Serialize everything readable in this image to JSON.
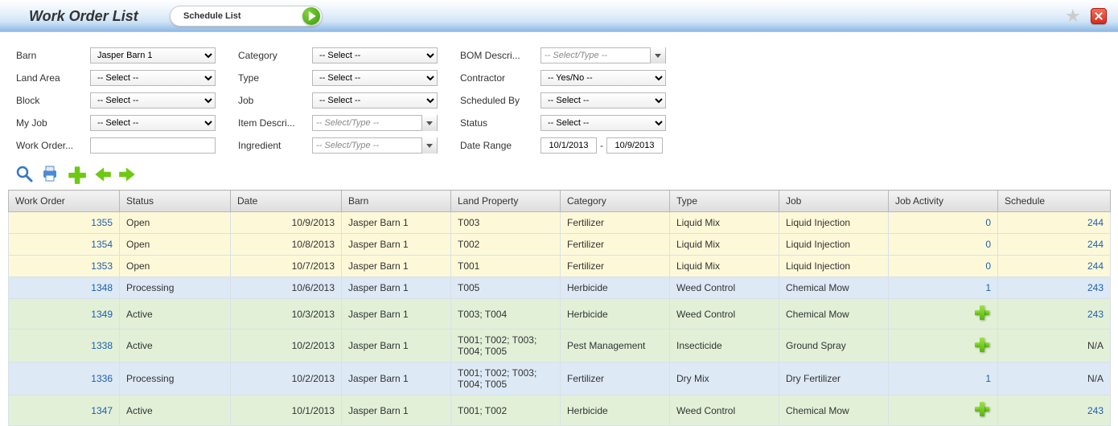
{
  "header": {
    "title": "Work Order List",
    "schedule_btn": "Schedule List"
  },
  "filters": {
    "col1": [
      {
        "label": "Barn",
        "type": "select",
        "value": "Jasper Barn 1"
      },
      {
        "label": "Land Area",
        "type": "select",
        "value": "-- Select --"
      },
      {
        "label": "Block",
        "type": "select",
        "value": "-- Select --"
      },
      {
        "label": "My Job",
        "type": "select",
        "value": "-- Select --"
      },
      {
        "label": "Work Order...",
        "type": "text",
        "value": ""
      }
    ],
    "col2": [
      {
        "label": "Category",
        "type": "select",
        "value": "-- Select --"
      },
      {
        "label": "Type",
        "type": "select",
        "value": "-- Select --"
      },
      {
        "label": "Job",
        "type": "select",
        "value": "-- Select --"
      },
      {
        "label": "Item Descri...",
        "type": "combo",
        "placeholder": "-- Select/Type --"
      },
      {
        "label": "Ingredient",
        "type": "combo",
        "placeholder": "-- Select/Type --"
      }
    ],
    "col3": [
      {
        "label": "BOM Descri...",
        "type": "combo",
        "placeholder": "-- Select/Type --"
      },
      {
        "label": "Contractor",
        "type": "select",
        "value": "-- Yes/No --"
      },
      {
        "label": "Scheduled By",
        "type": "select",
        "value": "-- Select --"
      },
      {
        "label": "Status",
        "type": "select",
        "value": "-- Select --"
      },
      {
        "label": "Date Range",
        "type": "daterange",
        "from": "10/1/2013",
        "to": "10/9/2013"
      }
    ]
  },
  "grid": {
    "columns": [
      "Work Order",
      "Status",
      "Date",
      "Barn",
      "Land Property",
      "Category",
      "Type",
      "Job",
      "Job Activity",
      "Schedule"
    ],
    "rows": [
      {
        "cls": "open",
        "wo": "1355",
        "status": "Open",
        "date": "10/9/2013",
        "barn": "Jasper Barn 1",
        "land": "T003",
        "cat": "Fertilizer",
        "type": "Liquid Mix",
        "job": "Liquid Injection",
        "act_kind": "link",
        "act_val": "0",
        "sched": "244"
      },
      {
        "cls": "open",
        "wo": "1354",
        "status": "Open",
        "date": "10/8/2013",
        "barn": "Jasper Barn 1",
        "land": "T002",
        "cat": "Fertilizer",
        "type": "Liquid Mix",
        "job": "Liquid Injection",
        "act_kind": "link",
        "act_val": "0",
        "sched": "244"
      },
      {
        "cls": "open",
        "wo": "1353",
        "status": "Open",
        "date": "10/7/2013",
        "barn": "Jasper Barn 1",
        "land": "T001",
        "cat": "Fertilizer",
        "type": "Liquid Mix",
        "job": "Liquid Injection",
        "act_kind": "link",
        "act_val": "0",
        "sched": "244"
      },
      {
        "cls": "processing",
        "wo": "1348",
        "status": "Processing",
        "date": "10/6/2013",
        "barn": "Jasper Barn 1",
        "land": "T005",
        "cat": "Herbicide",
        "type": "Weed Control",
        "job": "Chemical Mow",
        "act_kind": "link",
        "act_val": "1",
        "sched": "243"
      },
      {
        "cls": "active",
        "wo": "1349",
        "status": "Active",
        "date": "10/3/2013",
        "barn": "Jasper Barn 1",
        "land": "T003; T004",
        "cat": "Herbicide",
        "type": "Weed Control",
        "job": "Chemical Mow",
        "act_kind": "plus",
        "act_val": "",
        "sched": "243"
      },
      {
        "cls": "active",
        "wo": "1338",
        "status": "Active",
        "date": "10/2/2013",
        "barn": "Jasper Barn 1",
        "land": "T001; T002; T003; T004; T005",
        "cat": "Pest Management",
        "type": "Insecticide",
        "job": "Ground Spray",
        "act_kind": "plus",
        "act_val": "",
        "sched": "N/A"
      },
      {
        "cls": "processing",
        "wo": "1336",
        "status": "Processing",
        "date": "10/2/2013",
        "barn": "Jasper Barn 1",
        "land": "T001; T002; T003; T004; T005",
        "cat": "Fertilizer",
        "type": "Dry Mix",
        "job": "Dry Fertilizer",
        "act_kind": "link",
        "act_val": "1",
        "sched": "N/A"
      },
      {
        "cls": "active",
        "wo": "1347",
        "status": "Active",
        "date": "10/1/2013",
        "barn": "Jasper Barn 1",
        "land": "T001; T002",
        "cat": "Herbicide",
        "type": "Weed Control",
        "job": "Chemical Mow",
        "act_kind": "plus",
        "act_val": "",
        "sched": "243"
      }
    ]
  }
}
